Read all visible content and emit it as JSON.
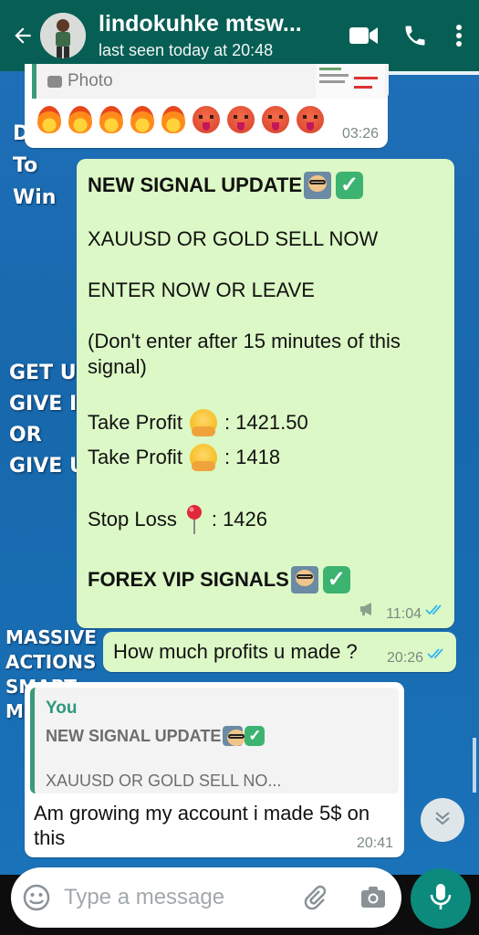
{
  "header": {
    "contact_name": "lindokuhke mtsw...",
    "last_seen": "last seen today at 20:48"
  },
  "wallpaper_text": {
    "line1": "Do",
    "line2": "To",
    "line3": "Win",
    "line4": "GET UP",
    "line5": "GIVE IT",
    "line6": "OR",
    "line7": "GIVE U",
    "line8": "MASSIVE",
    "line9": "ACTIONS",
    "line10": "SMART",
    "line11": "M"
  },
  "messages": {
    "m1": {
      "quote_label": "Photo",
      "time": "03:26"
    },
    "m2": {
      "line1": "NEW SIGNAL UPDATE",
      "line2": "XAUUSD OR GOLD SELL NOW",
      "line3": "ENTER NOW OR LEAVE",
      "line4": "(Don't enter after 15 minutes of this",
      "line5": "signal)",
      "tp1_label": "Take Profit",
      "tp1_value": ": 1421.50",
      "tp2_label": "Take Profit",
      "tp2_value": ": 1418",
      "sl_label": "Stop Loss",
      "sl_value": ": 1426",
      "footer": "FOREX VIP SIGNALS",
      "time": "11:04"
    },
    "m3": {
      "text": "How much profits u made ?",
      "time": "20:26"
    },
    "m4": {
      "quote_author": "You",
      "quote_title": "NEW SIGNAL UPDATE",
      "quote_snippet": "XAUUSD OR GOLD SELL NO...",
      "text_line1": "Am growing my account i made 5$ on",
      "text_line2": "this",
      "time": "20:41"
    }
  },
  "input": {
    "placeholder": "Type a message"
  },
  "colors": {
    "header": "#075e54",
    "outgoing_bubble": "#dcf8c6",
    "incoming_bubble": "#ffffff",
    "read_ticks": "#34b7f1",
    "mic_button": "#0c8b7d"
  }
}
